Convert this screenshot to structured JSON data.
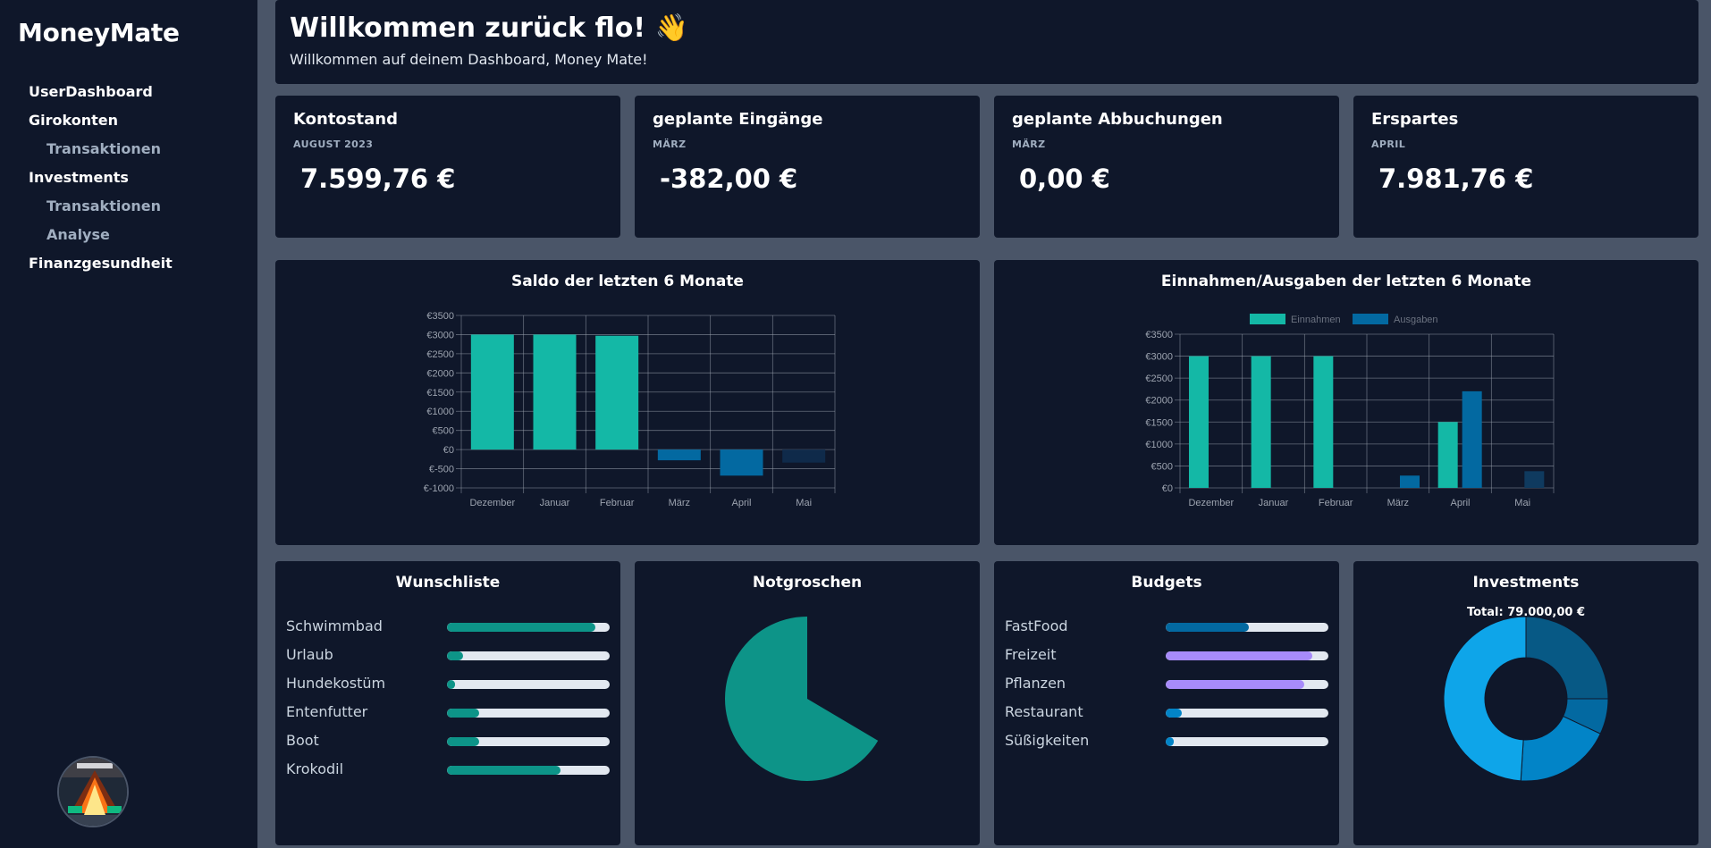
{
  "app": {
    "brand": "MoneyMate"
  },
  "sidebar": {
    "items": [
      {
        "label": "UserDashboard",
        "sub": false
      },
      {
        "label": "Girokonten",
        "sub": false
      },
      {
        "label": "Transaktionen",
        "sub": true
      },
      {
        "label": "Investments",
        "sub": false
      },
      {
        "label": "Transaktionen",
        "sub": true
      },
      {
        "label": "Analyse",
        "sub": true
      },
      {
        "label": "Finanzgesundheit",
        "sub": false
      }
    ]
  },
  "welcome": {
    "title": "Willkommen zurück flo! 👋",
    "subtitle": "Willkommen auf deinem Dashboard, Money Mate!"
  },
  "stats": [
    {
      "title": "Kontostand",
      "period": "AUGUST 2023",
      "value": "7.599,76 €"
    },
    {
      "title": "geplante Eingänge",
      "period": "MÄRZ",
      "value": "-382,00 €"
    },
    {
      "title": "geplante Abbuchungen",
      "period": "MÄRZ",
      "value": "0,00 €"
    },
    {
      "title": "Erspartes",
      "period": "APRIL",
      "value": "7.981,76 €"
    }
  ],
  "colors": {
    "teal": "#14b8a6",
    "blue": "#0369a1",
    "navy": "#0f2a4a",
    "dark_teal": "#0d9488",
    "purple": "#a78bfa",
    "sky": "#0ea5e9"
  },
  "chart_data": [
    {
      "type": "bar",
      "title": "Saldo der letzten 6 Monate",
      "categories": [
        "Dezember",
        "Januar",
        "Februar",
        "März",
        "April",
        "Mai"
      ],
      "values": [
        3000,
        3000,
        2970,
        -280,
        -680,
        -340
      ],
      "bar_colors": [
        "#14b8a6",
        "#14b8a6",
        "#14b8a6",
        "#0369a1",
        "#0369a1",
        "#0f2a4a"
      ],
      "ylim": [
        -1000,
        3500
      ],
      "yticks": [
        "€3500",
        "€3000",
        "€2500",
        "€2000",
        "€1500",
        "€1000",
        "€500",
        "€0",
        "€-500",
        "€-1000"
      ],
      "grid": true
    },
    {
      "type": "bar",
      "title": "Einnahmen/Ausgaben der letzten 6 Monate",
      "categories": [
        "Dezember",
        "Januar",
        "Februar",
        "März",
        "April",
        "Mai"
      ],
      "series": [
        {
          "name": "Einnahmen",
          "values": [
            3000,
            3000,
            3000,
            0,
            1500,
            0
          ]
        },
        {
          "name": "Ausgaben",
          "values": [
            0,
            0,
            0,
            280,
            2200,
            380
          ]
        }
      ],
      "ylim": [
        0,
        3500
      ],
      "yticks": [
        "€3500",
        "€3000",
        "€2500",
        "€2000",
        "€1500",
        "€1000",
        "€500",
        "€0"
      ],
      "legend": "top",
      "grid": true
    },
    {
      "type": "pie",
      "title": "Notgroschen",
      "values": [
        0.665,
        0.335
      ],
      "labels": [],
      "legend": "none"
    },
    {
      "type": "pie",
      "title": "Investments",
      "subtitle": "Total: 79.000,00 €",
      "values": [
        0.49,
        0.19,
        0.07,
        0.25
      ],
      "colors": [
        "#0ea5e9",
        "#0284c7",
        "#0369a1",
        "#075985"
      ]
    }
  ],
  "wishlist": {
    "title": "Wunschliste",
    "items": [
      {
        "label": "Schwimmbad",
        "progress": 0.91
      },
      {
        "label": "Urlaub",
        "progress": 0.1
      },
      {
        "label": "Hundekostüm",
        "progress": 0.05
      },
      {
        "label": "Entenfutter",
        "progress": 0.2
      },
      {
        "label": "Boot",
        "progress": 0.2
      },
      {
        "label": "Krokodil",
        "progress": 0.7
      }
    ]
  },
  "notgroschen": {
    "title": "Notgroschen"
  },
  "budgets": {
    "title": "Budgets",
    "items": [
      {
        "label": "FastFood",
        "progress": 0.51,
        "color": "#0369a1"
      },
      {
        "label": "Freizeit",
        "progress": 0.9,
        "color": "#a78bfa"
      },
      {
        "label": "Pflanzen",
        "progress": 0.85,
        "color": "#a78bfa"
      },
      {
        "label": "Restaurant",
        "progress": 0.1,
        "color": "#0284c7"
      },
      {
        "label": "Süßigkeiten",
        "progress": 0.05,
        "color": "#0284c7"
      }
    ]
  },
  "investments": {
    "title": "Investments",
    "total": "Total: 79.000,00 €"
  },
  "avatar": {
    "icon": "profile-avatar"
  }
}
